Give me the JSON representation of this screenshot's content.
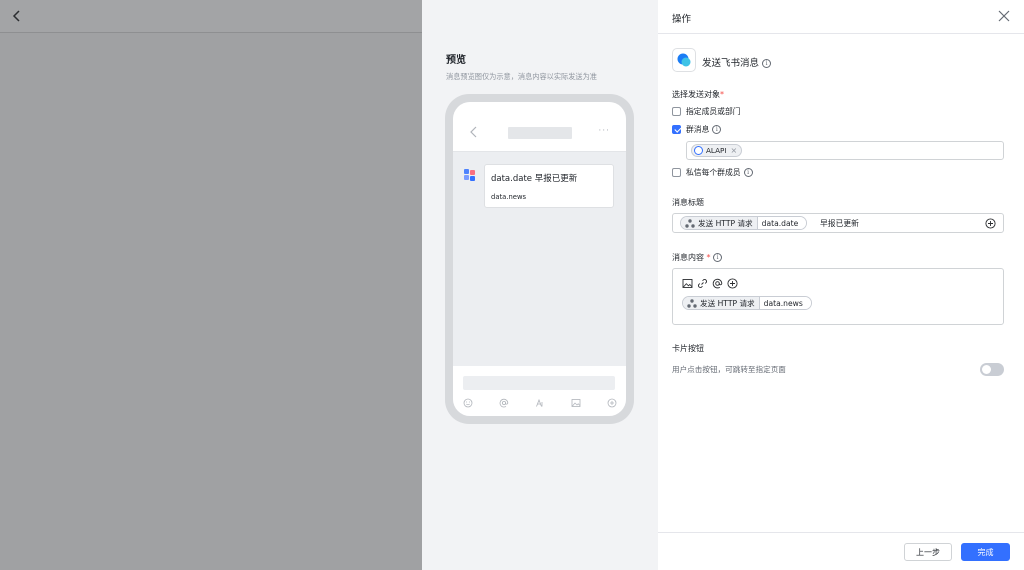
{
  "preview": {
    "title": "预览",
    "subtitle": "消息预览图仅为示意，消息内容以实际发送为准",
    "more_glyph": "···",
    "message": {
      "title": "data.date 早报已更新",
      "body": "data.news"
    }
  },
  "panel": {
    "title": "操作",
    "action_name": "发送飞书消息",
    "recipients": {
      "label": "选择发送对象",
      "required_mark": "*",
      "options": [
        {
          "label": "指定成员或部门",
          "checked": false
        },
        {
          "label": "群消息",
          "checked": true
        },
        {
          "label": "私信每个群成员",
          "checked": false
        }
      ],
      "selected_group": "ALAPI"
    },
    "message_title": {
      "label": "消息标题",
      "chip_source": "发送 HTTP 请求",
      "chip_value": "data.date",
      "suffix_text": "早报已更新"
    },
    "message_content": {
      "label": "消息内容",
      "required_mark": "*",
      "chip_source": "发送 HTTP 请求",
      "chip_value": "data.news"
    },
    "card_button": {
      "label": "卡片按钮",
      "hint": "用户点击按钮，可跳转至指定页面",
      "enabled": false
    },
    "footer": {
      "prev_label": "上一步",
      "done_label": "完成"
    }
  },
  "colors": {
    "accent": "#3370ff",
    "required": "#f54a45"
  }
}
